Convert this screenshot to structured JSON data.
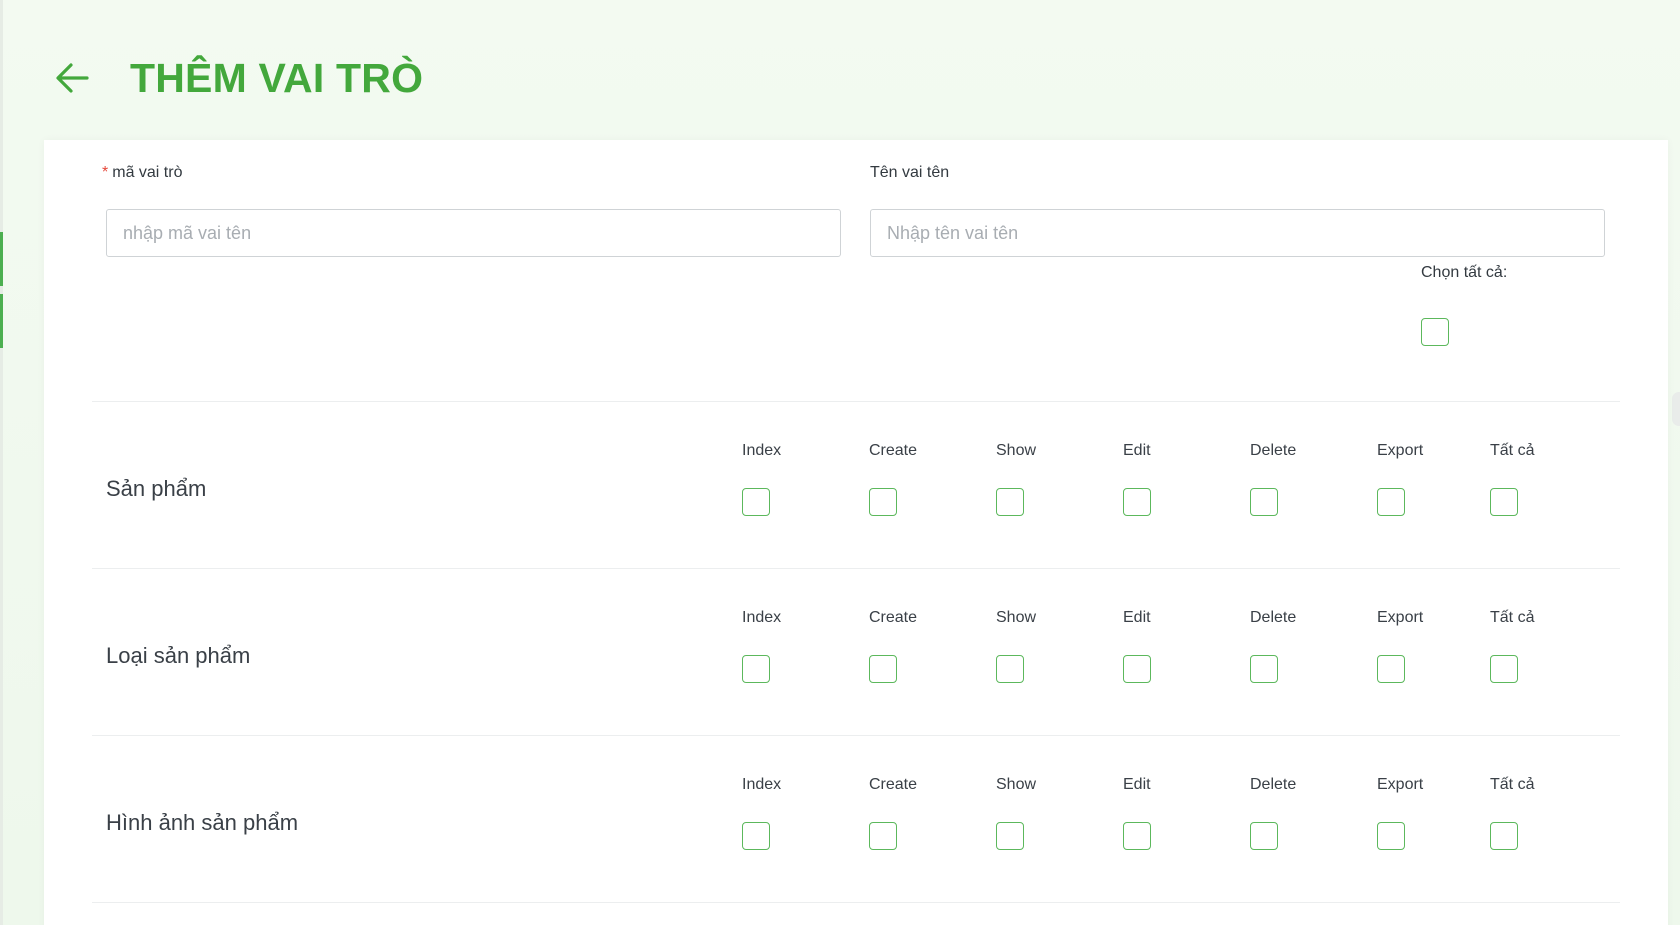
{
  "header": {
    "back_icon": "arrow-left-icon",
    "title": "THÊM VAI TRÒ"
  },
  "form": {
    "role_code": {
      "required_mark": "*",
      "label": "mã vai trò",
      "placeholder": "nhập mã vai tên",
      "value": ""
    },
    "role_name": {
      "label": "Tên vai tên",
      "placeholder": "Nhập tên vai tên",
      "value": ""
    },
    "select_all": {
      "label": "Chọn tất cả:",
      "checked": false
    }
  },
  "permission_columns": [
    "Index",
    "Create",
    "Show",
    "Edit",
    "Delete",
    "Export",
    "Tất cả"
  ],
  "modules": [
    {
      "name": "Sản phẩm"
    },
    {
      "name": "Loại sản phẩm"
    },
    {
      "name": "Hình ảnh sản phẩm"
    }
  ],
  "colors": {
    "accent": "#43a83c",
    "checkbox_border": "#5cb85c",
    "required": "#e5483b"
  }
}
